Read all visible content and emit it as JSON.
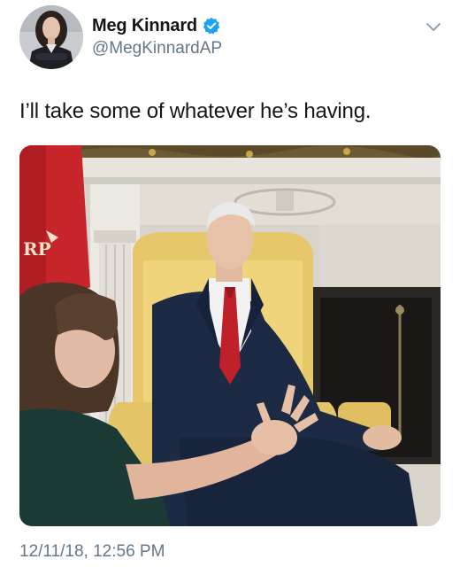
{
  "author": {
    "display_name": "Meg Kinnard",
    "handle": "@MegKinnardAP",
    "verified": true,
    "avatar_icon": "profile-photo-avatar",
    "verified_icon": "verified-badge-icon"
  },
  "tweet": {
    "text": "I’ll take some of whatever he’s having.",
    "timestamp": "12/11/18, 12:56 PM",
    "media_type": "photo"
  },
  "menu": {
    "icon": "chevron-down-icon"
  },
  "colors": {
    "primary_text": "#14171a",
    "secondary_text": "#657786",
    "verified_blue": "#1da1f2"
  }
}
